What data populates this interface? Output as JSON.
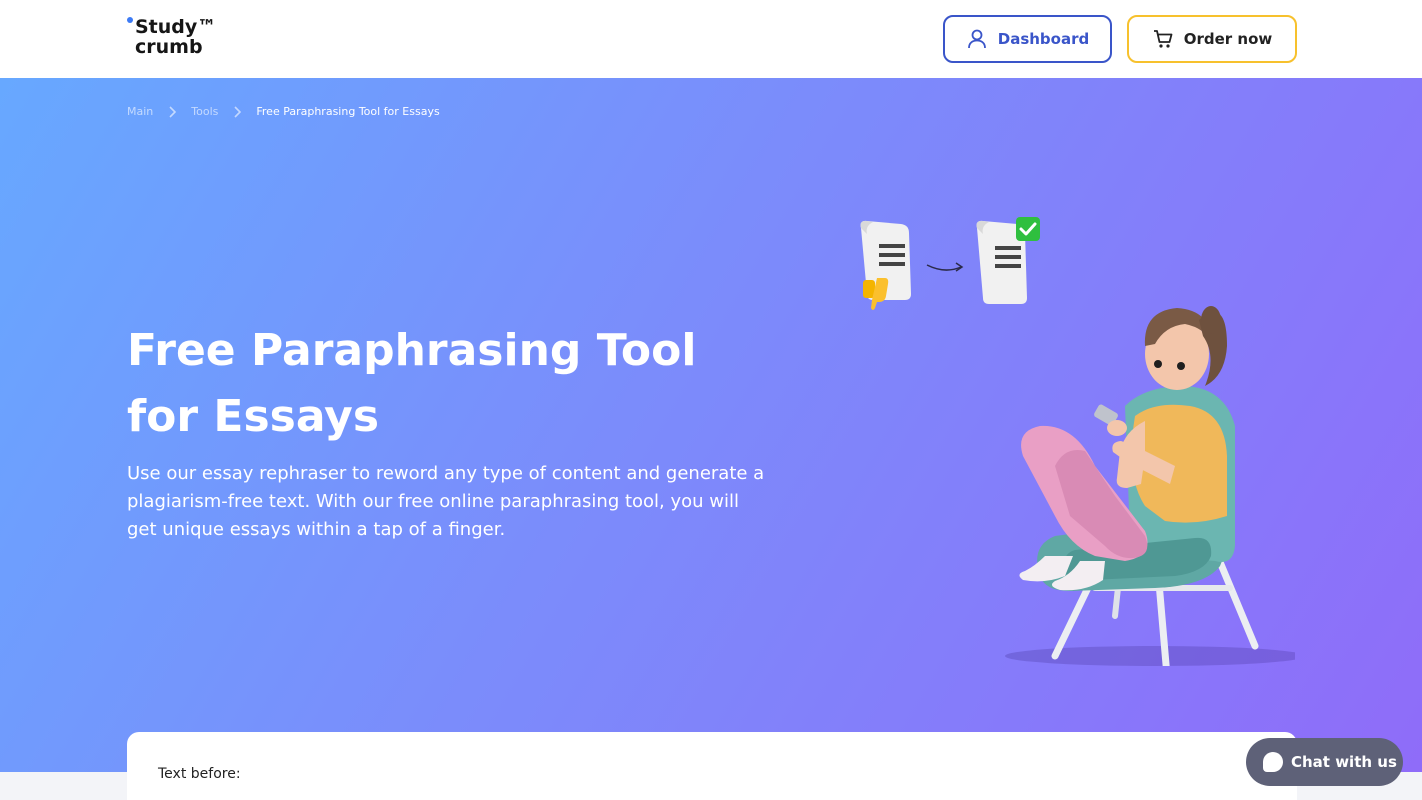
{
  "logo": {
    "line1": "Study™",
    "line2": "crumb"
  },
  "header": {
    "dashboard_label": "Dashboard",
    "order_label": "Order now",
    "dashboard_color": "#3a55c9",
    "order_border_color": "#f7c12d"
  },
  "breadcrumb": {
    "items": [
      "Main",
      "Tools"
    ],
    "current": "Free Paraphrasing Tool for Essays"
  },
  "hero": {
    "title": "Free Paraphrasing Tool for Essays",
    "description": "Use our essay rephraser to reword any type of content and generate a plagiarism-free text. With our free online paraphrasing tool, you will get unique essays within a tap of a finger.",
    "gradient_start": "#67a8ff",
    "gradient_end": "#8f6cf9"
  },
  "tool": {
    "text_before_label": "Text before:"
  },
  "chat": {
    "label": "Chat with us"
  },
  "icons": [
    "user-icon",
    "cart-icon",
    "chevron-right-icon",
    "chat-bubble-icon",
    "thumbs-down-icon",
    "checkmark-icon",
    "arrow-icon"
  ]
}
